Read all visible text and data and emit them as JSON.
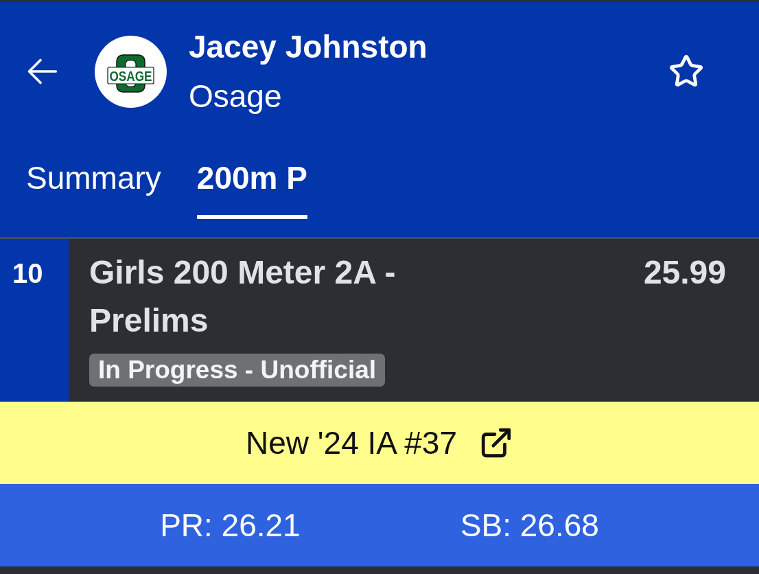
{
  "header": {
    "athlete_name": "Jacey Johnston",
    "team": "Osage",
    "logo_text": "OSAGE",
    "favorited": false
  },
  "tabs": [
    {
      "label": "Summary",
      "selected": false
    },
    {
      "label": "200m P",
      "selected": true
    }
  ],
  "event": {
    "place": "10",
    "title": "Girls 200 Meter 2A - Prelims",
    "mark": "25.99",
    "status": "In Progress - Unofficial"
  },
  "ranking_banner": {
    "text": "New '24 IA #37"
  },
  "stats": [
    {
      "label": "PR: 26.21"
    },
    {
      "label": "SB: 26.68"
    }
  ]
}
